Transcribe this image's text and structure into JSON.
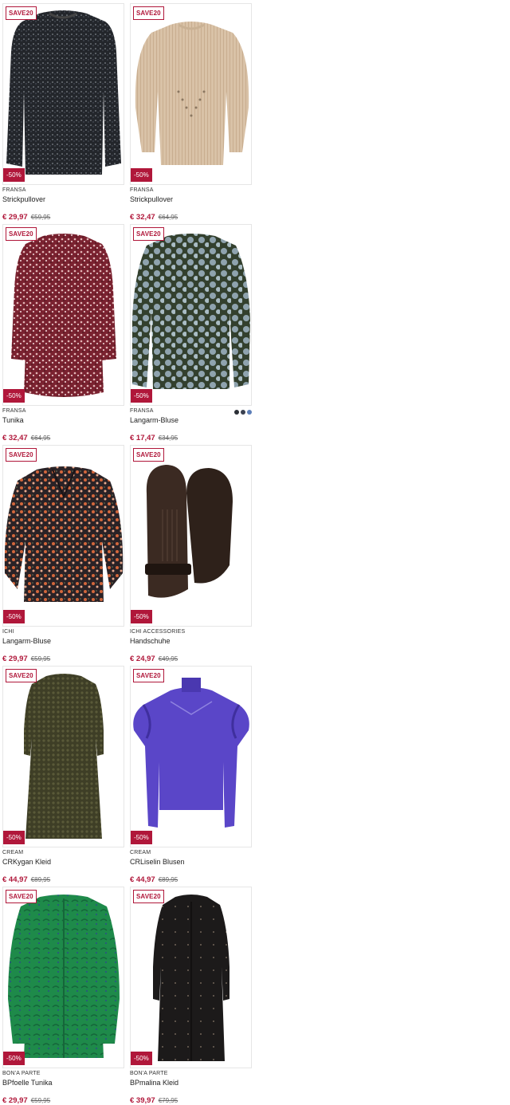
{
  "products": [
    {
      "brand": "FRANSA",
      "name": "Strickpullover",
      "price": "€ 29,97",
      "old_price": "€59,95",
      "promo": "SAVE20",
      "discount": "-50%",
      "image": "dark-knit-sweater"
    },
    {
      "brand": "FRANSA",
      "name": "Strickpullover",
      "price": "€ 32,47",
      "old_price": "€64,95",
      "promo": "SAVE20",
      "discount": "-50%",
      "image": "beige-knit-sweater"
    },
    {
      "brand": "FRANSA",
      "name": "Tunika",
      "price": "€ 32,47",
      "old_price": "€64,95",
      "promo": "SAVE20",
      "discount": "-50%",
      "image": "red-floral-tunic"
    },
    {
      "brand": "FRANSA",
      "name": "Langarm-Bluse",
      "price": "€ 17,47",
      "old_price": "€34,95",
      "promo": "SAVE20",
      "discount": "-50%",
      "image": "green-floral-blouse",
      "swatches": [
        "#2b2f36",
        "#3a4150",
        "#5c7eb8"
      ]
    },
    {
      "brand": "ICHI",
      "name": "Langarm-Bluse",
      "price": "€ 29,97",
      "old_price": "€59,95",
      "promo": "SAVE20",
      "discount": "-50%",
      "image": "floral-sheer-blouse"
    },
    {
      "brand": "ICHI ACCESSORIES",
      "name": "Handschuhe",
      "price": "€ 24,97",
      "old_price": "€49,95",
      "promo": "SAVE20",
      "discount": "-50%",
      "image": "leather-mittens"
    },
    {
      "brand": "CREAM",
      "name": "CRKygan Kleid",
      "price": "€ 44,97",
      "old_price": "€89,95",
      "promo": "SAVE20",
      "discount": "-50%",
      "image": "olive-textured-dress"
    },
    {
      "brand": "CREAM",
      "name": "CRLiselin Blusen",
      "price": "€ 44,97",
      "old_price": "€89,95",
      "promo": "SAVE20",
      "discount": "-50%",
      "image": "purple-ruffle-blouse"
    },
    {
      "brand": "BON'A PARTE",
      "name": "BPfoelle Tunika",
      "price": "€ 29,97",
      "old_price": "€59,95",
      "promo": "SAVE20",
      "discount": "-50%",
      "image": "green-satin-tunic"
    },
    {
      "brand": "BON'A PARTE",
      "name": "BPmalina Kleid",
      "price": "€ 39,97",
      "old_price": "€79,95",
      "promo": "SAVE20",
      "discount": "-50%",
      "image": "black-shirt-dress"
    }
  ]
}
